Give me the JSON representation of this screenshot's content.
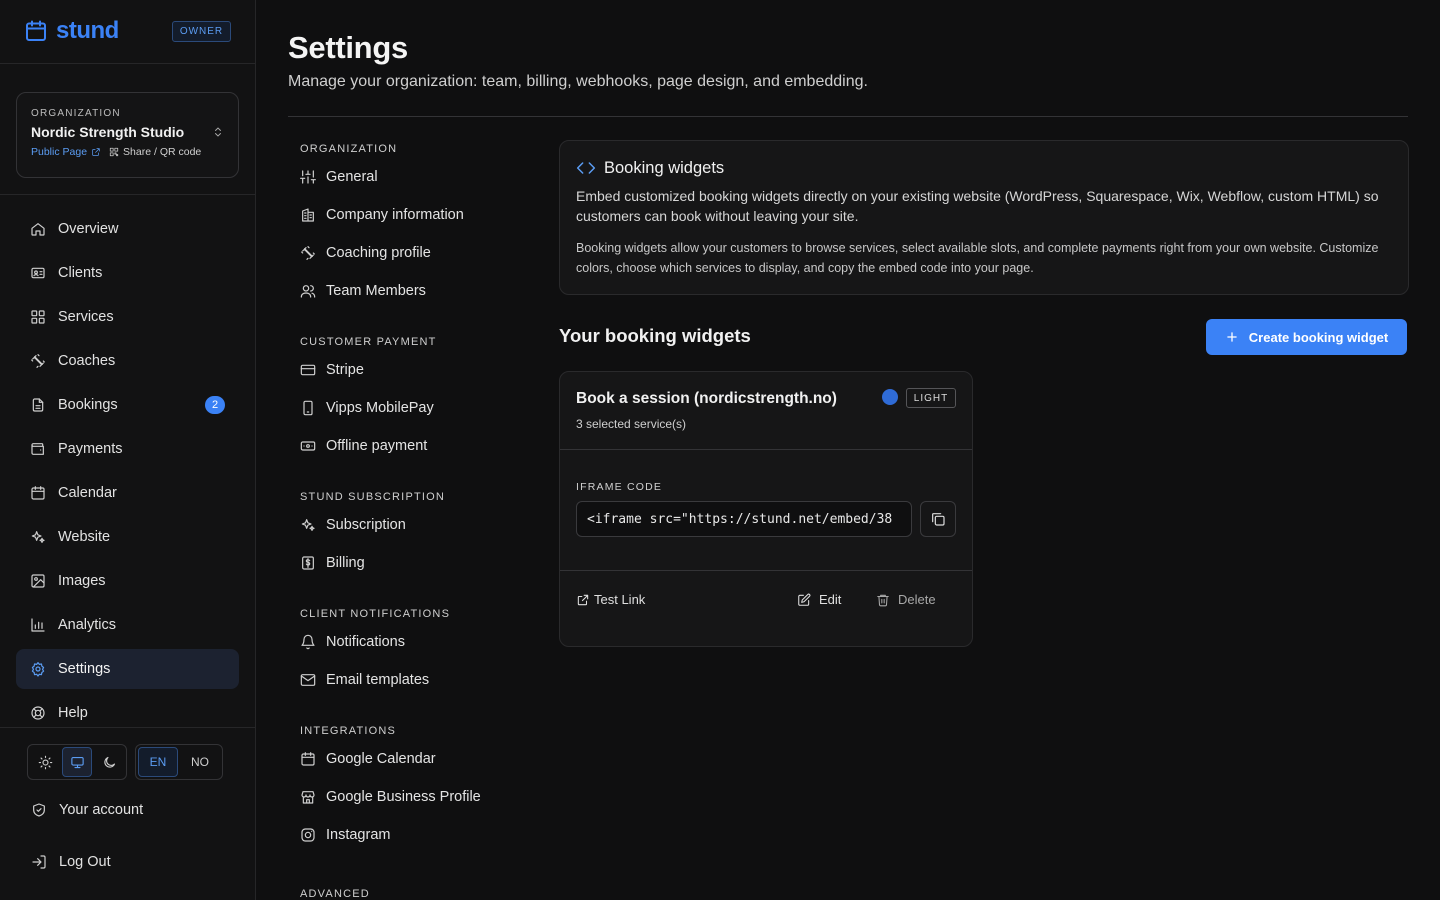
{
  "brand": {
    "name": "stund",
    "role_badge": "OWNER",
    "icon": "calendar-icon"
  },
  "organization": {
    "label": "ORGANIZATION",
    "name": "Nordic Strength Studio",
    "public_page": "Public Page",
    "share": "Share / QR code"
  },
  "sidebar": {
    "items": [
      {
        "label": "Overview",
        "icon": "home-icon"
      },
      {
        "label": "Clients",
        "icon": "id-card-icon"
      },
      {
        "label": "Services",
        "icon": "grid-icon"
      },
      {
        "label": "Coaches",
        "icon": "dumbbell-icon"
      },
      {
        "label": "Bookings",
        "icon": "document-icon",
        "badge": "2"
      },
      {
        "label": "Payments",
        "icon": "wallet-icon"
      },
      {
        "label": "Calendar",
        "icon": "calendar-icon"
      },
      {
        "label": "Website",
        "icon": "sparkles-icon"
      },
      {
        "label": "Images",
        "icon": "image-icon"
      },
      {
        "label": "Analytics",
        "icon": "bar-chart-icon"
      },
      {
        "label": "Settings",
        "icon": "gear-icon",
        "active": true
      },
      {
        "label": "Help",
        "icon": "lifebuoy-icon"
      }
    ],
    "lang": {
      "en": "EN",
      "no": "NO"
    },
    "account": "Your account",
    "logout": "Log Out"
  },
  "page": {
    "title": "Settings",
    "subtitle": "Manage your organization: team, billing, webhooks, page design, and embedding."
  },
  "settings_nav": {
    "organization": "ORGANIZATION",
    "general": "General",
    "company": "Company information",
    "coaching": "Coaching profile",
    "team": "Team Members",
    "customer_payment": "CUSTOMER PAYMENT",
    "stripe": "Stripe",
    "vipps": "Vipps MobilePay",
    "offline": "Offline payment",
    "subscription_section": "STUND SUBSCRIPTION",
    "subscription": "Subscription",
    "billing": "Billing",
    "client_notifications": "CLIENT NOTIFICATIONS",
    "notifications": "Notifications",
    "email_templates": "Email templates",
    "integrations": "INTEGRATIONS",
    "google_calendar": "Google Calendar",
    "google_business": "Google Business Profile",
    "instagram": "Instagram",
    "advanced": "ADVANCED"
  },
  "info": {
    "title": "Booking widgets",
    "text1": "Embed customized booking widgets directly on your existing website (WordPress, Squarespace, Wix, Webflow, custom HTML) so customers can book without leaving your site.",
    "text2": "Booking widgets allow your customers to browse services, select available slots, and complete payments right from your own website. Customize colors, choose which services to display, and copy the embed code into your page."
  },
  "widgets": {
    "heading": "Your booking widgets",
    "create_label": "Create booking widget",
    "card": {
      "title": "Book a session (nordicstrength.no)",
      "services": "3 selected service(s)",
      "color": "#2f6bd6",
      "theme": "LIGHT",
      "code_label": "IFRAME CODE",
      "code": "<iframe src=\"https://stund.net/embed/38",
      "test_link": "Test Link",
      "edit": "Edit",
      "delete": "Delete"
    }
  },
  "colors": {
    "accent": "#3b82f6",
    "background": "#0f0f10"
  }
}
